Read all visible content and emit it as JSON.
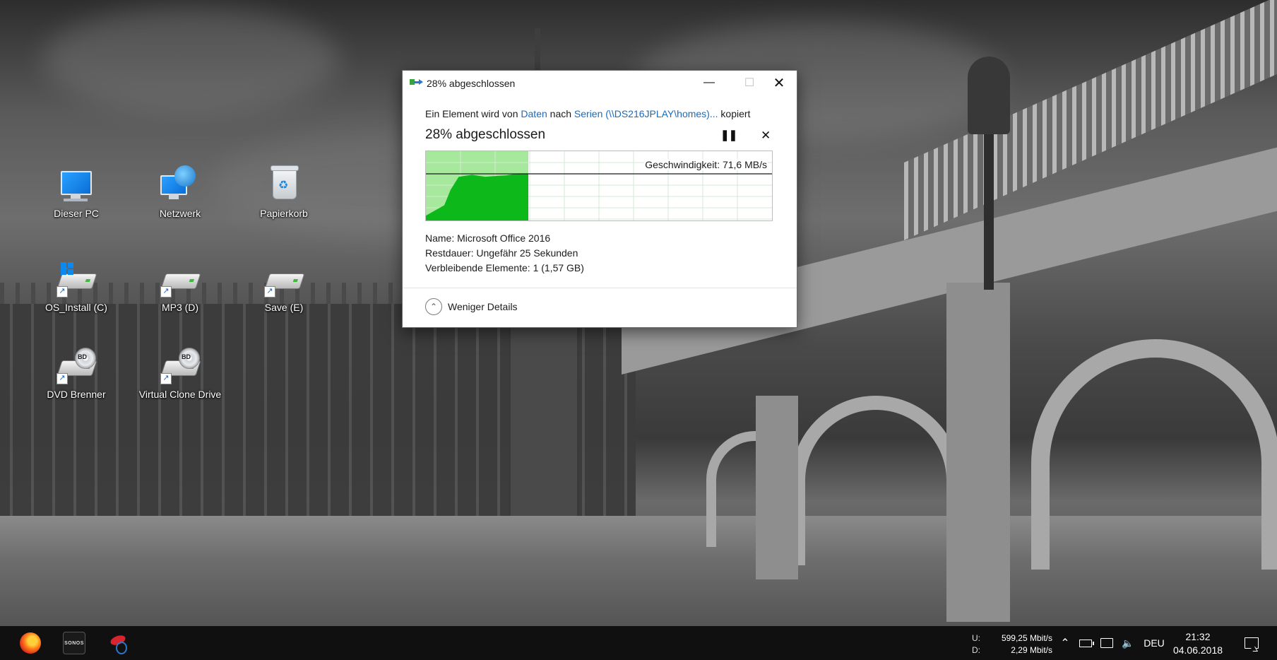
{
  "desktop": {
    "icons": [
      {
        "label": "Dieser PC"
      },
      {
        "label": "Netzwerk"
      },
      {
        "label": "Papierkorb"
      },
      {
        "label": "OS_Install (C)"
      },
      {
        "label": "MP3 (D)"
      },
      {
        "label": "Save (E)"
      },
      {
        "label": "DVD Brenner"
      },
      {
        "label": "Virtual Clone Drive"
      }
    ],
    "disc_badge": "BD"
  },
  "dialog": {
    "title": "28% abgeschlossen",
    "from_prefix": "Ein Element wird von",
    "from_source": "Daten",
    "from_mid": "nach",
    "from_target": "Serien (\\\\DS216JPLAY\\homes)...",
    "from_suffix": "kopiert",
    "status": "28% abgeschlossen",
    "speed": "Geschwindigkeit: 71,6 MB/s",
    "progress_fraction": 0.28,
    "name_label": "Name:",
    "name_value": "Microsoft Office 2016",
    "remaining_label": "Restdauer:",
    "remaining_value": "Ungefähr 25 Sekunden",
    "items_label": "Verbleibende Elemente:",
    "items_value": "1 (1,57 GB)",
    "less_details": "Weniger Details",
    "window_buttons": {
      "minimize": "minimize-icon",
      "maximize": "maximize-icon",
      "close": "close-icon"
    },
    "colors": {
      "graph_fill": "#0cb81a",
      "graph_bg_done": "#a6e89c",
      "link": "#1a6bbd"
    }
  },
  "taskbar": {
    "apps": [
      "firefox-icon",
      "sonos-icon",
      "snipping-tool-icon"
    ],
    "sonos_text": "SONOS",
    "net_upload_label": "U:",
    "net_download_label": "D:",
    "net_upload_value": "599,25 Mbit/s",
    "net_download_value": "2,29 Mbit/s",
    "language": "DEU",
    "time": "21:32",
    "date": "04.06.2018",
    "colors": {
      "background": "#101010"
    }
  }
}
